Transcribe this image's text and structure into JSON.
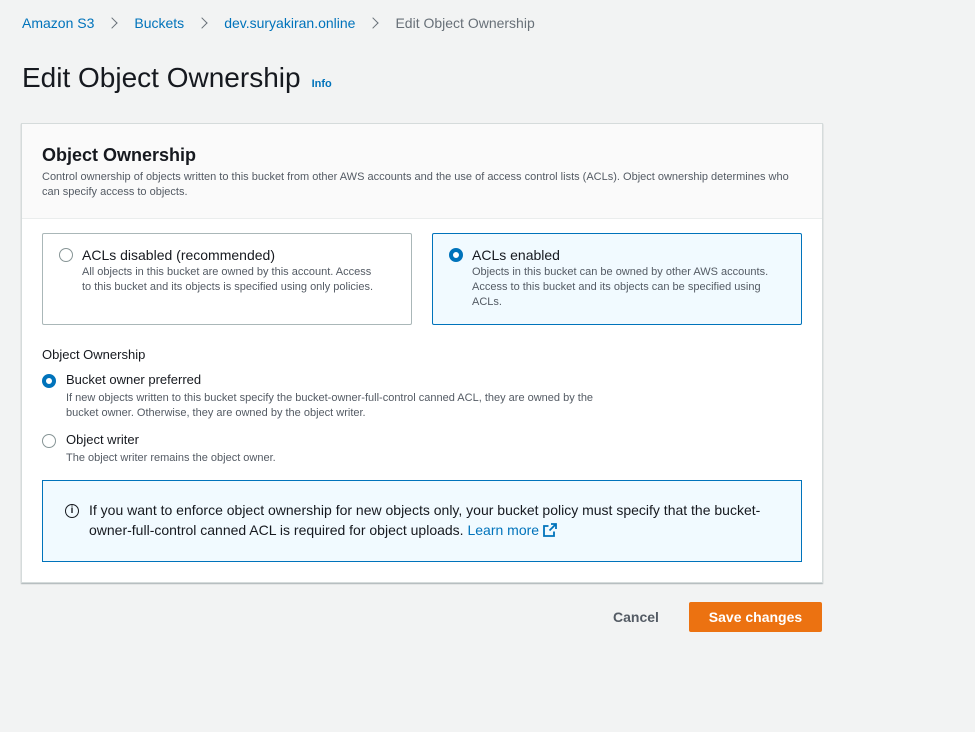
{
  "breadcrumb": {
    "items": [
      "Amazon S3",
      "Buckets",
      "dev.suryakiran.online"
    ],
    "current": "Edit Object Ownership"
  },
  "page": {
    "title": "Edit Object Ownership",
    "info_label": "Info"
  },
  "panel": {
    "title": "Object Ownership",
    "description": "Control ownership of objects written to this bucket from other AWS accounts and the use of access control lists (ACLs). Object ownership determines who can specify access to objects."
  },
  "acl_tiles": [
    {
      "label": "ACLs disabled (recommended)",
      "description": "All objects in this bucket are owned by this account. Access to this bucket and its objects is specified using only policies.",
      "selected": false
    },
    {
      "label": "ACLs enabled",
      "description": "Objects in this bucket can be owned by other AWS accounts. Access to this bucket and its objects can be specified using ACLs.",
      "selected": true
    }
  ],
  "ownership": {
    "label": "Object Ownership",
    "options": [
      {
        "label": "Bucket owner preferred",
        "description": "If new objects written to this bucket specify the bucket-owner-full-control canned ACL, they are owned by the bucket owner. Otherwise, they are owned by the object writer.",
        "selected": true
      },
      {
        "label": "Object writer",
        "description": "The object writer remains the object owner.",
        "selected": false
      }
    ]
  },
  "alert": {
    "icon": "info-circle-icon",
    "text": "If you want to enforce object ownership for new objects only, your bucket policy must specify that the bucket-owner-full-control canned ACL is required for object uploads.",
    "link_label": "Learn more",
    "link_icon": "external-link-icon"
  },
  "actions": {
    "cancel_label": "Cancel",
    "save_label": "Save changes"
  },
  "colors": {
    "link": "#0073bb",
    "primary_button": "#ec7211",
    "selected_tile_bg": "#f1faff",
    "page_bg": "#f2f3f3"
  }
}
